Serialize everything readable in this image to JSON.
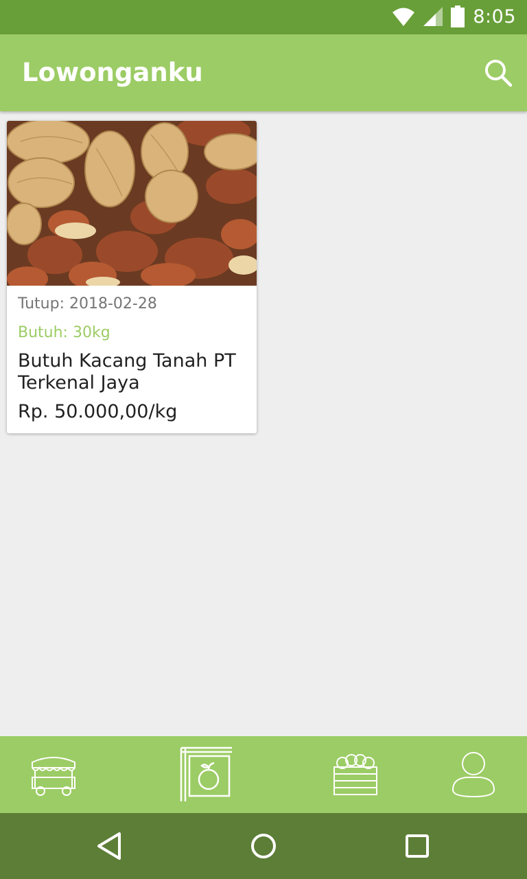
{
  "status_bar": {
    "time": "8:05",
    "icons": [
      "wifi-icon",
      "signal-icon",
      "battery-icon"
    ]
  },
  "app_bar": {
    "title": "Lowonganku",
    "search_icon": "search-icon"
  },
  "listing": {
    "image_alt": "peanuts",
    "close_date": "Tutup: 2018-02-28",
    "need": "Butuh: 30kg",
    "title": "Butuh Kacang Tanah PT Terkenal Jaya",
    "price": "Rp. 50.000,00/kg"
  },
  "bottom_nav": {
    "items": [
      {
        "icon": "cart-stall-icon",
        "selected": false
      },
      {
        "icon": "fruit-signboard-icon",
        "selected": true
      },
      {
        "icon": "produce-crate-icon",
        "selected": false
      },
      {
        "icon": "profile-icon",
        "selected": false
      }
    ]
  },
  "system_nav": [
    "back-icon",
    "home-icon",
    "recents-icon"
  ],
  "colors": {
    "status_bar": "#689f38",
    "primary": "#9ccc65",
    "system_nav": "#5d7e37",
    "background": "#eeeeee"
  }
}
